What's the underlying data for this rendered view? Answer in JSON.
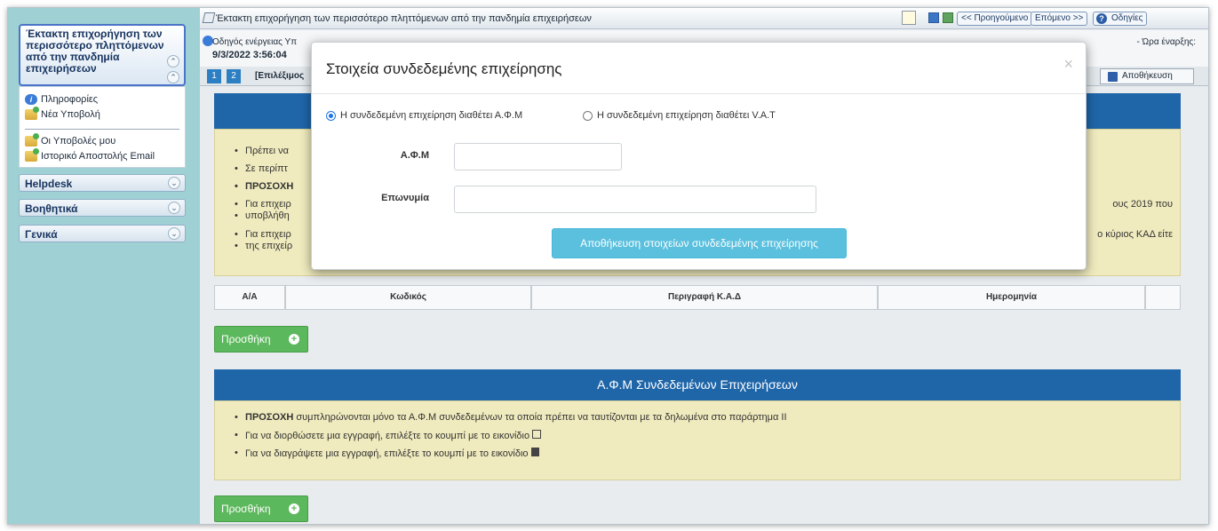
{
  "sidebar": {
    "active_section": {
      "title": "Έκτακτη επιχορήγηση των περισσότερο πληττόμενων από την πανδημία επιχειρήσεων",
      "line1": "Έκτακτη επιχορήγηση των",
      "line2": "περισσότερο πληττόμενων",
      "line3": "από την πανδημία",
      "line4": "επιχειρήσεων"
    },
    "items": [
      {
        "label": "Πληροφορίες",
        "icon": "info-icon"
      },
      {
        "label": "Νέα Υποβολή",
        "icon": "folder-add-icon"
      },
      {
        "label": "Οι Υποβολές μου",
        "icon": "folder-add-icon"
      },
      {
        "label": "Ιστορικό Αποστολής Email",
        "icon": "folder-add-icon"
      }
    ],
    "sections": [
      {
        "label": "Helpdesk"
      },
      {
        "label": "Βοηθητικά"
      },
      {
        "label": "Γενικά"
      }
    ]
  },
  "topbar": {
    "title": "Έκτακτη επιχορήγηση των περισσότερο πληττόμενων από την πανδημία επιχειρήσεων",
    "prev": "<< Προηγούμενο",
    "next": "Επόμενο >>",
    "help": "Οδηγίες"
  },
  "infobar": {
    "line1": "Οδηγός ενέργειας Υπ",
    "line2": "9/3/2022 3:56:04",
    "right": "- Ώρα έναρξης:"
  },
  "stepbar": {
    "steps": [
      "1",
      "2"
    ],
    "label": "[Επιλέξιμος",
    "save": "Αποθήκευση"
  },
  "notes1": {
    "items": [
      "Πρέπει να",
      "Σε περίπτ",
      "ΠΡΟΣΟΧΗ",
      "Για επιχειρ",
      "υποβλήθη",
      "Για επιχειρ",
      "της επιχείρ"
    ],
    "right1": "ους 2019 που",
    "right2": "ο κύριος ΚΑΔ είτε"
  },
  "kad_table": {
    "headers": [
      "Α/Α",
      "Κωδικός",
      "Περιγραφή Κ.Α.Δ",
      "Ημερομηνία",
      ""
    ]
  },
  "add_button": "Προσθήκη",
  "section2": {
    "title": "Α.Φ.Μ Συνδεδεμένων Επιχειρήσεων",
    "note_bold": "ΠΡΟΣΟΧΗ",
    "note1": " συμπληρώνονται μόνο τα Α.Φ.Μ συνδεδεμένων τα οποία πρέπει να ταυτίζονται με τα δηλωμένα στο παράρτημα ΙΙ",
    "note2": "Για να διορθώσετε μια εγγραφή, επιλέξτε το κουμπί με το εικονίδιο",
    "note3": "Για να διαγράψετε μια εγγραφή, επιλέξτε το κουμπί με το εικονίδιο"
  },
  "modal": {
    "title": "Στοιχεία συνδεδεμένης επιχείρησης",
    "close": "×",
    "radio_afm": "Η συνδεδεμένη επιχείρηση διαθέτει Α.Φ.Μ",
    "radio_vat": "Η συνδεδεμένη επιχείρηση διαθέτει V.A.T",
    "afm_label": "Α.Φ.Μ",
    "afm_value": "",
    "name_label": "Επωνυμία",
    "name_value": "",
    "save_button": "Αποθήκευση στοιχείων συνδεδεμένης επιχείρησης"
  },
  "colors": {
    "band": "#1f66a9",
    "note_bg": "#f0ebbe",
    "sidebar_bg": "#9fd0d3",
    "add_green": "#5cb85c",
    "modal_btn": "#5bc0de"
  }
}
